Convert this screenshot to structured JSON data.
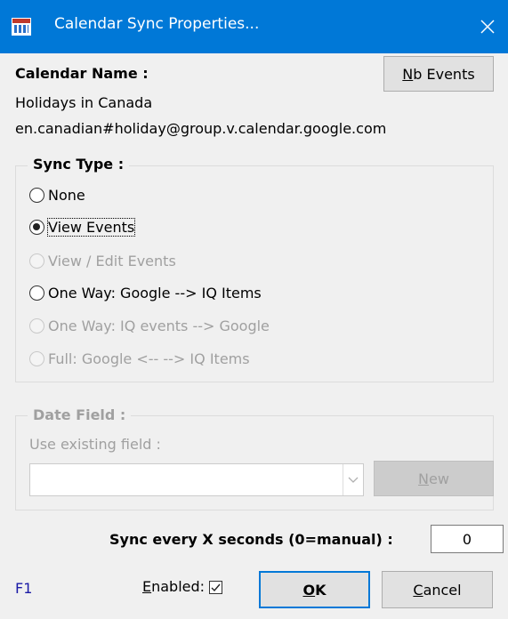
{
  "window": {
    "title": "Calendar Sync Properties..."
  },
  "calendar": {
    "name_label": "Calendar Name :",
    "name_value": "Holidays in Canada",
    "id_value": "en.canadian#holiday@group.v.calendar.google.com",
    "nb_events_button": {
      "mnemonic": "N",
      "rest": "b Events"
    }
  },
  "sync_type": {
    "legend": "Sync Type :",
    "options": [
      {
        "label": "None",
        "selected": false,
        "enabled": true
      },
      {
        "label": "View Events",
        "selected": true,
        "enabled": true
      },
      {
        "label": "View / Edit Events",
        "selected": false,
        "enabled": false
      },
      {
        "label": "One Way: Google --> IQ Items",
        "selected": false,
        "enabled": true
      },
      {
        "label": "One Way: IQ events --> Google",
        "selected": false,
        "enabled": false
      },
      {
        "label": "Full: Google <-- --> IQ Items",
        "selected": false,
        "enabled": false
      }
    ]
  },
  "date_field": {
    "legend": "Date Field :",
    "use_existing_label": "Use existing field :",
    "combo_value": "",
    "new_button": {
      "mnemonic": "N",
      "rest": "ew"
    }
  },
  "sync_interval": {
    "label": "Sync every X seconds (0=manual) :",
    "value": "0"
  },
  "footer": {
    "help_key": "F1",
    "enabled_label": {
      "mnemonic": "E",
      "rest": "nabled:"
    },
    "enabled_checked": true,
    "ok_button": {
      "mnemonic": "O",
      "rest": "K"
    },
    "cancel_button": {
      "mnemonic": "C",
      "rest": "ancel"
    }
  },
  "colors": {
    "titlebar": "#0078d7",
    "dialog_bg": "#f0f0f0",
    "help_key": "#1a1aa6"
  }
}
